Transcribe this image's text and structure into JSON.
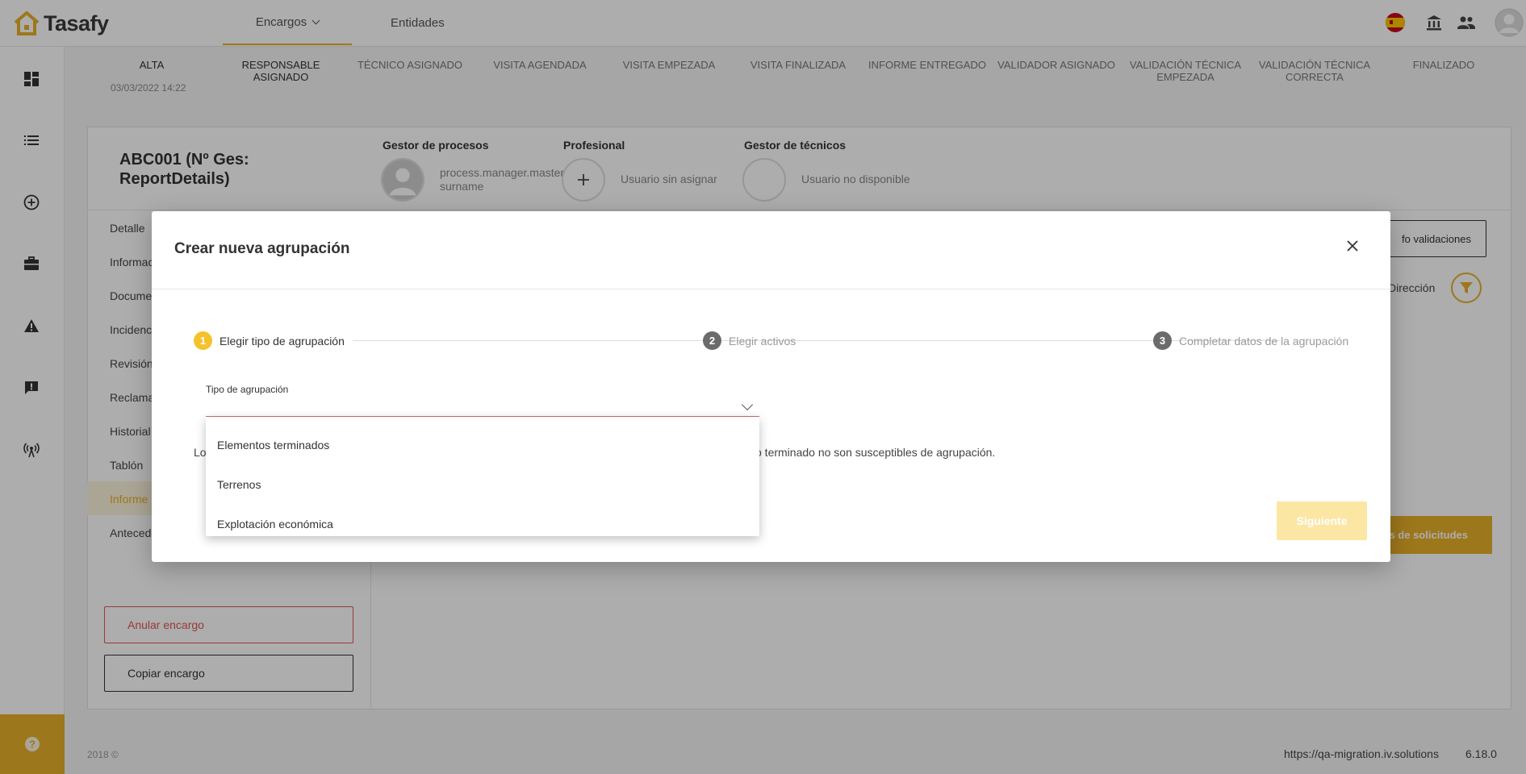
{
  "header": {
    "brand": "Tasafy",
    "nav": [
      {
        "label": "Encargos"
      },
      {
        "label": "Entidades"
      }
    ]
  },
  "workflow": {
    "steps": [
      {
        "label": "ALTA"
      },
      {
        "label": "RESPONSABLE ASIGNADO"
      },
      {
        "label": "TÉCNICO ASIGNADO"
      },
      {
        "label": "VISITA AGENDADA"
      },
      {
        "label": "VISITA EMPEZADA"
      },
      {
        "label": "VISITA FINALIZADA"
      },
      {
        "label": "INFORME ENTREGADO"
      },
      {
        "label": "VALIDADOR ASIGNADO"
      },
      {
        "label": "VALIDACIÓN TÉCNICA EMPEZADA"
      },
      {
        "label": "VALIDACIÓN TÉCNICA CORRECTA"
      },
      {
        "label": "FINALIZADO"
      }
    ],
    "date": "03/03/2022 14:22"
  },
  "report": {
    "title": "ABC001 (Nº Ges: ReportDetails)",
    "process_manager_label": "Gestor de procesos",
    "process_manager_name": "process.manager.master surname",
    "professional_label": "Profesional",
    "professional_value": "Usuario sin asignar",
    "tech_manager_label": "Gestor de técnicos",
    "tech_manager_value": "Usuario no disponible"
  },
  "left_menu": {
    "items": [
      {
        "label": "Detalle"
      },
      {
        "label": "Informac"
      },
      {
        "label": "Docume"
      },
      {
        "label": "Incidenc"
      },
      {
        "label": "Revisión"
      },
      {
        "label": "Reclama"
      },
      {
        "label": "Historial"
      },
      {
        "label": "Tablón"
      },
      {
        "label": "Informe"
      },
      {
        "label": "Anteced"
      }
    ],
    "cancel_label": "Anular encargo",
    "copy_label": "Copiar encargo"
  },
  "content": {
    "info_validations_label": "fo validaciones",
    "direction_label": "Dirección",
    "requests_button": "os de solicitudes"
  },
  "footer": {
    "copyright": "2018 ©",
    "url": "https://qa-migration.iv.solutions",
    "version": "6.18.0"
  },
  "modal": {
    "title": "Crear nueva agrupación",
    "steps": [
      {
        "num": "1",
        "label": "Elegir tipo de agrupación"
      },
      {
        "num": "2",
        "label": "Elegir activos"
      },
      {
        "num": "3",
        "label": "Completar datos de la agrupación"
      }
    ],
    "field_label": "Tipo de agrupación",
    "note_prefix": "Lo",
    "note_suffix": "o terminado no son susceptibles de agrupación.",
    "next_label": "Siguiente",
    "options": [
      {
        "label": "Elementos terminados"
      },
      {
        "label": "Terrenos"
      },
      {
        "label": "Explotación económica"
      }
    ]
  },
  "colors": {
    "accent": "#e8b028",
    "step_active": "#f5c22a",
    "danger": "#e05555"
  }
}
